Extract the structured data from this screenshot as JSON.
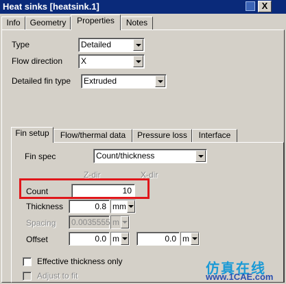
{
  "window": {
    "title": "Heat sinks [heatsink.1]",
    "close_label": "X"
  },
  "top_tabs": [
    {
      "label": "Info"
    },
    {
      "label": "Geometry"
    },
    {
      "label": "Properties"
    },
    {
      "label": "Notes"
    }
  ],
  "properties": {
    "type_label": "Type",
    "type_value": "Detailed",
    "flow_direction_label": "Flow direction",
    "flow_direction_value": "X",
    "fin_type_label": "Detailed fin type",
    "fin_type_value": "Extruded"
  },
  "inner_tabs": [
    {
      "label": "Fin setup"
    },
    {
      "label": "Flow/thermal data"
    },
    {
      "label": "Pressure loss"
    },
    {
      "label": "Interface"
    }
  ],
  "fin_setup": {
    "fin_spec_label": "Fin spec",
    "fin_spec_value": "Count/thickness",
    "zdir_header": "Z-dir",
    "xdir_header": "X-dir",
    "count_label": "Count",
    "count_value": "10",
    "thickness_label": "Thickness",
    "thickness_value": "0.8",
    "thickness_unit": "mm",
    "spacing_label": "Spacing",
    "spacing_value": "0.0035555",
    "spacing_unit": "m",
    "offset_label": "Offset",
    "offset_z_value": "0.0",
    "offset_z_unit": "m",
    "offset_x_value": "0.0",
    "offset_x_unit": "m",
    "effective_thickness_label": "Effective thickness only",
    "adjust_to_fit_label": "Adjust to fit"
  },
  "watermark": {
    "text": "仿真在线",
    "url": "www.1CAE.com"
  },
  "colors": {
    "title_bar": "#0a2a7a",
    "dialog_bg": "#d4d0c8",
    "highlight": "#e0161a",
    "watermark": "#1a9ad6"
  }
}
